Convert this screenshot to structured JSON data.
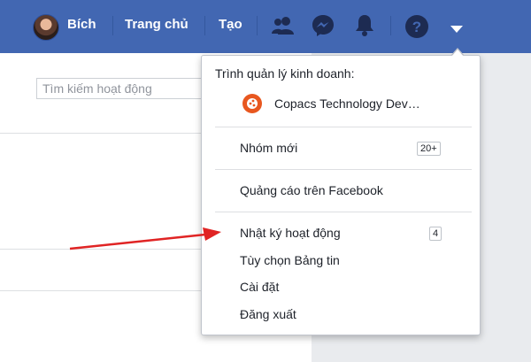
{
  "header": {
    "profile_name": "Bích",
    "home_label": "Trang chủ",
    "create_label": "Tạo",
    "accent": "#4267b2"
  },
  "page": {
    "search_placeholder": "Tìm kiếm hoạt động"
  },
  "menu": {
    "business_manager_title": "Trình quản lý kinh doanh:",
    "business_name": "Copacs Technology Dev…",
    "items": [
      {
        "label": "Nhóm mới",
        "badge": "20+"
      },
      {
        "label": "Quảng cáo trên Facebook",
        "badge": null
      },
      {
        "label": "Nhật ký hoạt động",
        "badge": "4"
      },
      {
        "label": "Tùy chọn Bảng tin",
        "badge": null
      },
      {
        "label": "Cài đặt",
        "badge": null
      },
      {
        "label": "Đăng xuất",
        "badge": null
      }
    ]
  },
  "annotation": {
    "arrow_color": "#e02424"
  }
}
